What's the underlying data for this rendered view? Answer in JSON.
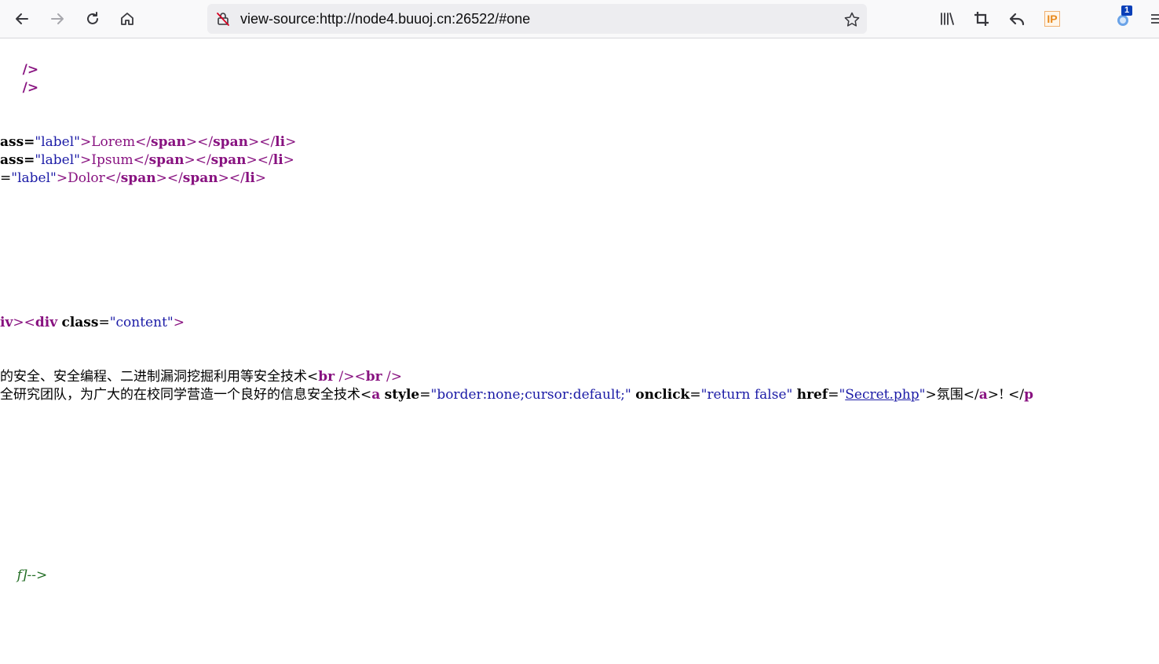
{
  "browser": {
    "url": "view-source:http://node4.buuoj.cn:26522/#one",
    "extension_badge": "1",
    "ip_label": "IP"
  },
  "source": {
    "line1": "/>",
    "line2": "/>",
    "lorem": {
      "prefix": "ass=",
      "value": "\"label\"",
      "text": ">Lorem</",
      "t1": "span",
      "m1": "></",
      "t2": "span",
      "m2": "></",
      "t3": "li",
      "end": ">"
    },
    "ipsum": {
      "prefix": "ass=",
      "value": "\"label\"",
      "text": ">Ipsum</",
      "t1": "span",
      "m1": "></",
      "t2": "span",
      "m2": "></",
      "t3": "li",
      "end": ">"
    },
    "dolor": {
      "prefix": "=",
      "value": "\"label\"",
      "text": ">Dolor</",
      "t1": "span",
      "m1": "></",
      "t2": "span",
      "m2": "></",
      "t3": "li",
      "end": ">"
    },
    "div_line": {
      "t0": "iv",
      "m0": "><",
      "t1": "div",
      "sp": " ",
      "attr": "class",
      "eq": "=",
      "value": "\"content\"",
      "end": ">"
    },
    "cn1": {
      "text": "的安全、安全编程、二进制漏洞挖掘利用等安全技术<",
      "t1": "br",
      "m1": " /><",
      "t2": "br",
      "end": " />"
    },
    "cn2": {
      "text": "全研究团队，为广大的在校同学营造一个良好的信息安全技术<",
      "t1": "a",
      "a1": "style",
      "v1": "\"border:none;cursor:default;\"",
      "a2": "onclick",
      "v2": "\"return false\"",
      "a3": "href",
      "q_open": "\"",
      "link": "Secret.php",
      "q_close": "\"",
      "after": ">氛围</",
      "t2": "a",
      "after2": ">! </",
      "t3": "p"
    },
    "comment": "f]-->"
  }
}
